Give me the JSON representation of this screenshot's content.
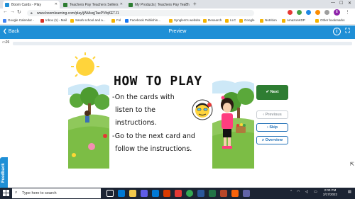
{
  "browser": {
    "tabs": [
      {
        "label": "Boom Cards - Play",
        "active": true,
        "favicon_color": "#1f8fd6"
      },
      {
        "label": "Teachers Pay Teachers Sellers",
        "active": false,
        "favicon_color": "#2e7d32"
      },
      {
        "label": "My Products | Teachers Pay Teach",
        "active": false,
        "favicon_color": "#2e7d32"
      }
    ],
    "new_tab": "+",
    "url": "www.boomlearning.com/play/jWiAsqjTaePVfqKETJ1",
    "profile_initial": "E",
    "bookmarks": [
      {
        "label": "Google Calendar -",
        "color": "#4285f4"
      },
      {
        "label": "Inbox (1) - Mail",
        "color": "#d93025"
      },
      {
        "label": "Sarah school and a...",
        "color": "#fbbc04"
      },
      {
        "label": "Fol",
        "color": "#f5b400"
      },
      {
        "label": "Facebook Publishin...",
        "color": "#1877f2"
      },
      {
        "label": "Synglers's website",
        "color": "#f5b400"
      },
      {
        "label": "Research",
        "color": "#f5b400"
      },
      {
        "label": "LLC",
        "color": "#f5b400"
      },
      {
        "label": "Google",
        "color": "#f5b400"
      },
      {
        "label": "Nutrition",
        "color": "#f5b400"
      },
      {
        "label": "AmazonKDP",
        "color": "#f5b400"
      },
      {
        "label": "Other bookmarks",
        "color": "#f5b400"
      }
    ]
  },
  "app": {
    "back_label": "Back",
    "title": "Preview",
    "count": "26",
    "info_icon": "i",
    "fullscreen_icon": "⛶"
  },
  "card": {
    "title": "HOW TO PLAY",
    "lines": [
      "-On the cards with",
      "listen to the",
      "instructions.",
      "-Go to the next card and",
      "follow the instructions."
    ]
  },
  "controls": {
    "next": "Next",
    "previous": "Previous",
    "skip": "Skip",
    "overview": "Overview"
  },
  "feedback_label": "Feedback",
  "taskbar": {
    "search_placeholder": "Type here to search",
    "time": "2:00 PM",
    "date": "2/17/2022"
  },
  "colors": {
    "accent": "#1f8fd6",
    "next_button": "#2e7d32",
    "taskbar": "#1c2433"
  }
}
